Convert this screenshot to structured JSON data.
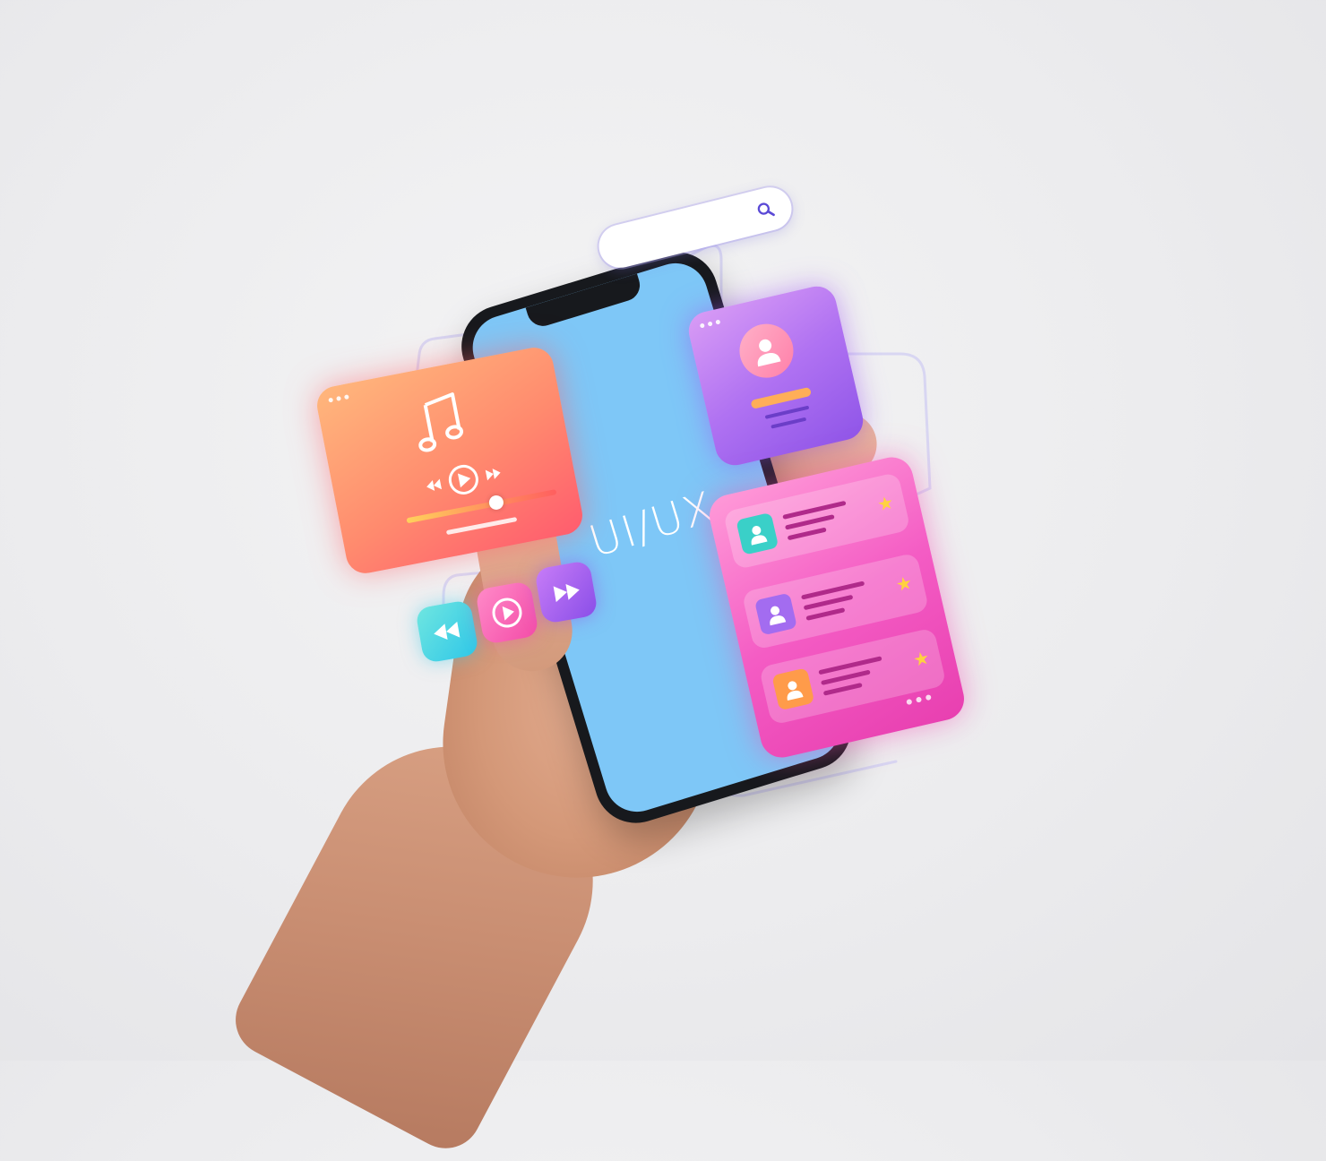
{
  "phone": {
    "screen_text": "UI/UX",
    "screen_color": "#7ec7f7"
  },
  "search": {
    "icon": "search-icon"
  },
  "music_card": {
    "icons": [
      "music-note-icon",
      "rewind-icon",
      "play-icon",
      "fast-forward-icon"
    ],
    "progress": 0.6
  },
  "controls": {
    "icons": [
      "rewind-icon",
      "play-icon",
      "fast-forward-icon"
    ]
  },
  "profile_card": {
    "icon": "user-avatar-icon"
  },
  "list_card": {
    "rows": [
      {
        "icon": "user-icon",
        "thumb_color": "#3ad0c8",
        "rating_icon": "star-icon"
      },
      {
        "icon": "user-icon",
        "thumb_color": "#a36cf0",
        "rating_icon": "star-icon"
      },
      {
        "icon": "user-icon",
        "thumb_color": "#ff9b4a",
        "rating_icon": "star-icon"
      }
    ]
  },
  "colors": {
    "background": "#ececee",
    "accent_orange": "#ff8a6e",
    "accent_purple": "#b072f2",
    "accent_pink": "#f45cc4",
    "accent_cyan": "#2fc7e8"
  }
}
